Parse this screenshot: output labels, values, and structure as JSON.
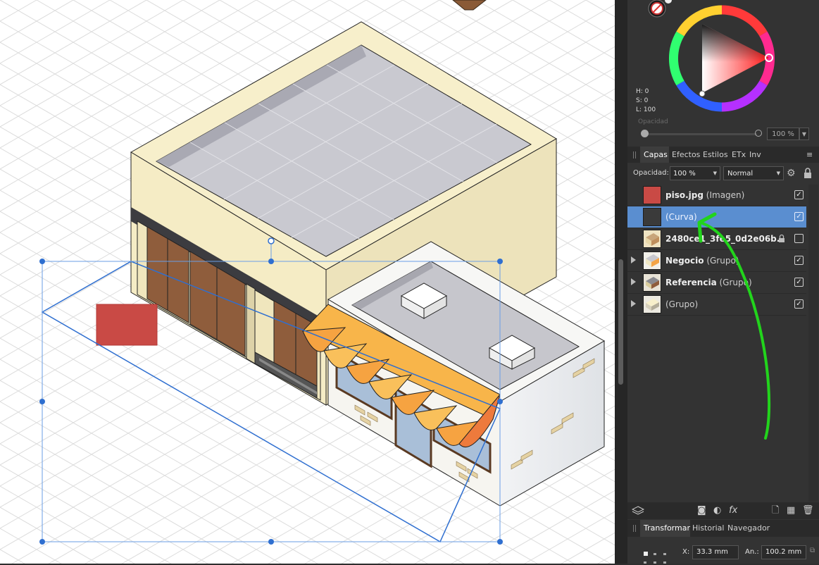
{
  "color_panel": {
    "h": "H: 0",
    "s": "S: 0",
    "l": "L: 100",
    "opacity_label": "Opacidad",
    "opacity_value": "100 %"
  },
  "tabs": [
    {
      "label": "Capas",
      "active": true
    },
    {
      "label": "Efectos",
      "active": false
    },
    {
      "label": "Estilos",
      "active": false
    },
    {
      "label": "ETx",
      "active": false
    },
    {
      "label": "Inv",
      "active": false
    }
  ],
  "layers_controls": {
    "opacity_label": "Opacidad:",
    "opacity_value": "100 %",
    "blend_mode": "Normal"
  },
  "layers": [
    {
      "name": "piso.jpg",
      "type": "(Imagen)",
      "visible": true,
      "selected": false,
      "expandable": false,
      "locked": false
    },
    {
      "name": "",
      "type": "(Curva)",
      "visible": true,
      "selected": true,
      "expandable": false,
      "locked": false
    },
    {
      "name": "2480ce1_3fe5_0d2e06b...",
      "type": "",
      "visible": false,
      "selected": false,
      "expandable": false,
      "locked": true
    },
    {
      "name": "Negocio",
      "type": "(Grupo)",
      "visible": true,
      "selected": false,
      "expandable": true,
      "locked": false
    },
    {
      "name": "Referencia",
      "type": "(Grupo)",
      "visible": true,
      "selected": false,
      "expandable": true,
      "locked": false
    },
    {
      "name": "",
      "type": "(Grupo)",
      "visible": true,
      "selected": false,
      "expandable": true,
      "locked": false
    }
  ],
  "bottom_tabs": [
    {
      "label": "Transformar",
      "active": true
    },
    {
      "label": "Historial",
      "active": false
    },
    {
      "label": "Navegador",
      "active": false
    }
  ],
  "transform": {
    "x_label": "X:",
    "x_value": "33.3 mm",
    "w_label": "An.:",
    "w_value": "100.2 mm"
  },
  "colors": {
    "panel_bg": "#333333",
    "selection_blue": "#5a8ed0",
    "annotation_green": "#22d41c",
    "floor_texture_red": "#c94a45",
    "selection_handle": "#2f6fd0"
  }
}
